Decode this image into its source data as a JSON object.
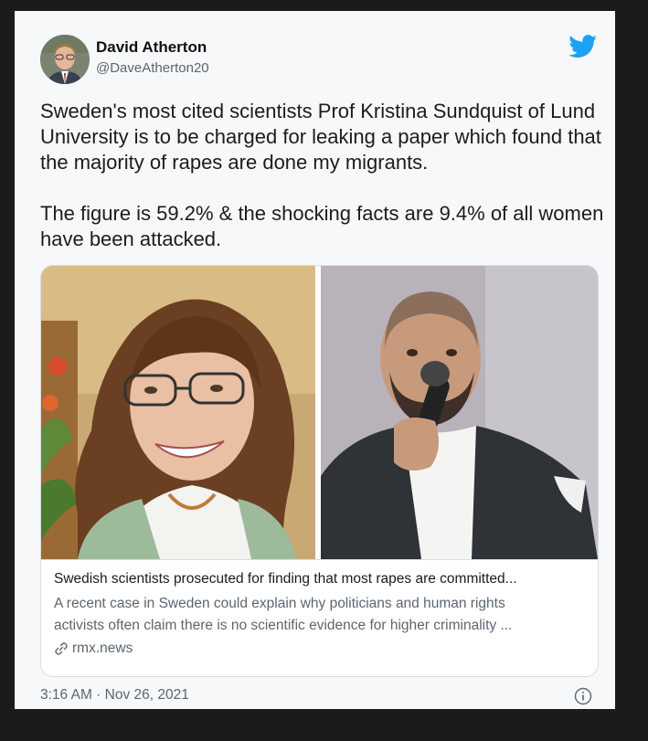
{
  "tweet": {
    "author_name": "David Atherton",
    "author_handle": "@DaveAtherton20",
    "text_paragraphs": [
      "Sweden's most cited scientists Prof Kristina Sundquist of Lund University is to be charged for leaking a paper which found that the majority of rapes are done my migrants.",
      "The figure is 59.2% & the shocking facts are 9.4% of all women have been attacked."
    ],
    "timestamp": "3:16 AM · Nov 26, 2021"
  },
  "link_card": {
    "title": "Swedish scientists prosecuted for finding that most rapes are committed...",
    "description_lines": [
      "A recent case in Sweden could explain why politicians and human rights",
      "activists often claim there is no scientific evidence for higher criminality ..."
    ],
    "domain": "rmx.news"
  },
  "icons": {
    "logo": "twitter-bird-icon",
    "link": "link-icon",
    "info": "info-icon"
  },
  "colors": {
    "twitter_blue": "#1da1f2",
    "card_background": "#f7f8f9",
    "muted_text": "#5b6670"
  }
}
